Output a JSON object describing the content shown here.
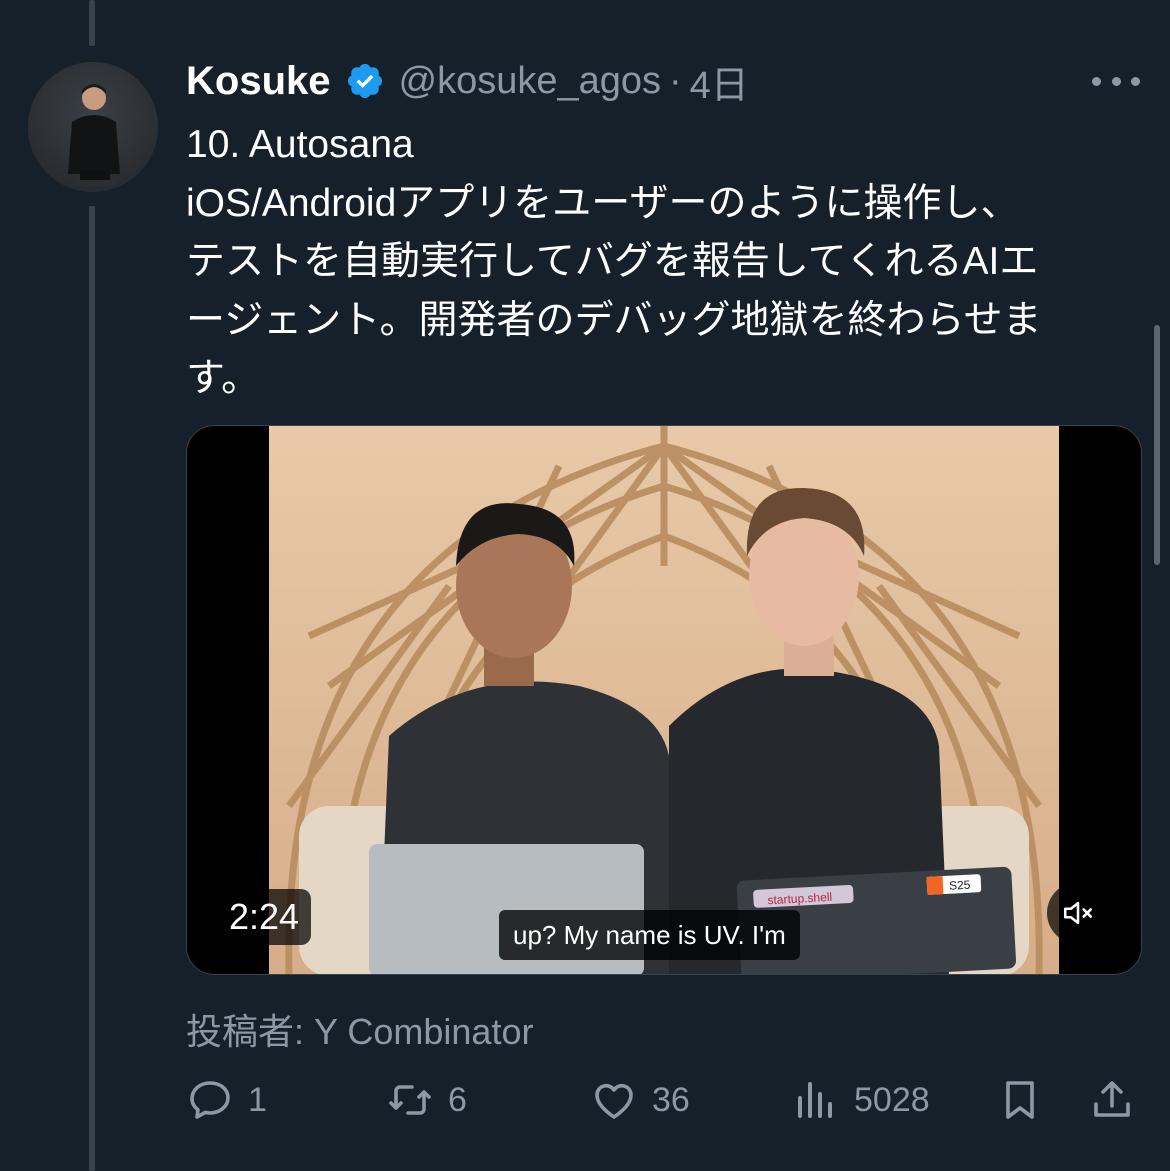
{
  "author": {
    "name": "Kosuke",
    "handle": "@kosuke_agos",
    "separator": "·",
    "time": "4日"
  },
  "tweet": {
    "lines": [
      "10. Autosana",
      "iOS/Androidアプリをユーザーのように操作し、",
      "テストを自動実行してバグを報告してくれるAIエ",
      "ージェント。開発者のデバッグ地獄を終わらせま",
      "す。"
    ]
  },
  "video": {
    "duration": "2:24",
    "caption": "up? My name is UV. I'm",
    "laptop_sticker": "startup.shell",
    "laptop_badge": "S25"
  },
  "source": "投稿者: Y Combinator",
  "actions": {
    "reply": {
      "icon": "reply-icon",
      "count": "1"
    },
    "retweet": {
      "icon": "retweet-icon",
      "count": "6"
    },
    "like": {
      "icon": "heart-icon",
      "count": "36"
    },
    "views": {
      "icon": "views-icon",
      "count": "5028"
    },
    "bookmark": {
      "icon": "bookmark-icon"
    },
    "share": {
      "icon": "share-icon"
    }
  },
  "colors": {
    "background": "#15202b",
    "muted_text": "#8b98a5",
    "verified_blue": "#1d9bf0",
    "thread_line": "#38444d"
  }
}
